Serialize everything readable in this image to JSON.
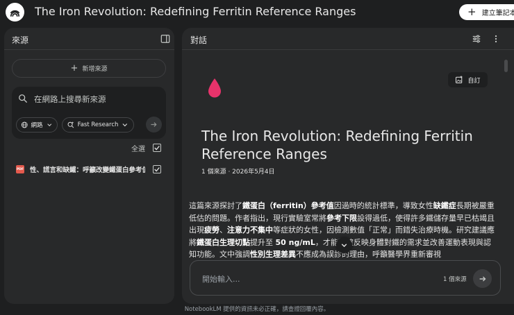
{
  "app": {
    "title": "The Iron Revolution: Redefining Ferritin Reference Ranges",
    "create_notebook_label": "建立筆記本"
  },
  "sources_panel": {
    "title": "來源",
    "add_source_label": "新增來源",
    "search": {
      "placeholder": "在網路上搜尋新來源",
      "chips": [
        {
          "label": "網路",
          "icon": "globe-icon"
        },
        {
          "label": "Fast Research",
          "icon": "research-icon"
        }
      ]
    },
    "select_all_label": "全選",
    "select_all_checked": true,
    "items": [
      {
        "label": "性、謊言和缺鐵：呼籲改變鐵蛋白參考值範圍",
        "type": "PDF",
        "checked": true
      }
    ]
  },
  "chat_panel": {
    "title": "對話",
    "customize_label": "自訂",
    "doc_title": "The Iron Revolution: Redefining Ferritin Reference Ranges",
    "doc_meta": "1 個來源 · 2026年5月4日",
    "summary": [
      {
        "t": "這篇來源探討了"
      },
      {
        "t": "鐵蛋白（ferritin）參考值",
        "b": true
      },
      {
        "t": "因過時的統計標準，導致女性"
      },
      {
        "t": "缺鐵症",
        "b": true
      },
      {
        "t": "長期被嚴重低估的問題。作者指出，現行實驗室常將"
      },
      {
        "t": "參考下限",
        "b": true
      },
      {
        "t": "設得過低，使得許多鐵儲存量早已枯竭且出現"
      },
      {
        "t": "疲勞",
        "b": true
      },
      {
        "t": "、"
      },
      {
        "t": "注意力不集中",
        "b": true
      },
      {
        "t": "等症狀的女性，因檢測數值「正常」而錯失治療時機。研究建議應將"
      },
      {
        "t": "鐵蛋白生理切點",
        "b": true
      },
      {
        "t": "提升至 "
      },
      {
        "t": "50 ng/mL",
        "b": true
      },
      {
        "t": "，才能精確反映身體對鐵的需求並改善運動表現與認知功能。文中強調"
      },
      {
        "t": "性別生理差異",
        "b": true
      },
      {
        "t": "不應成為誤診的理由，呼籲醫學界重新審視"
      }
    ],
    "input_placeholder": "開始輸入...",
    "source_count_label": "1 個來源"
  },
  "footer": {
    "disclaimer": "NotebookLM 提供的資訊未必正確，請查證回覆內容。"
  },
  "colors": {
    "background": "#1e1f20",
    "panel": "#28292a",
    "pdf_red": "#e45a4d",
    "drop_pink": "#e8336b"
  }
}
